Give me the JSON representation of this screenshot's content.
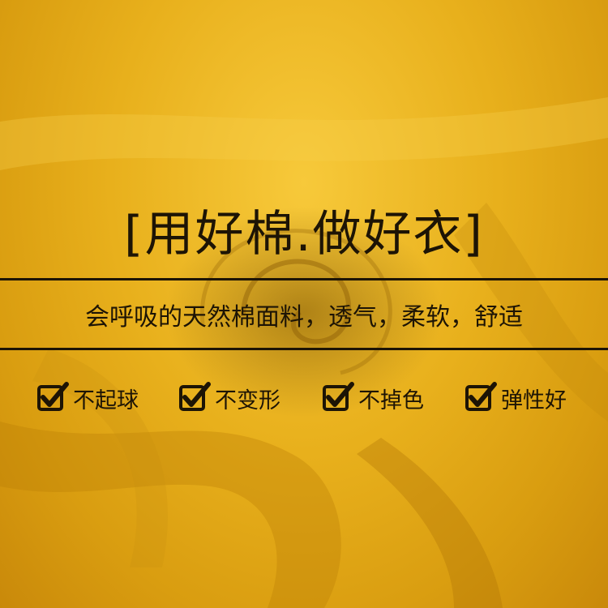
{
  "title": "[用好棉.做好衣]",
  "subtitle": "会呼吸的天然棉面料，透气，柔软，舒适",
  "features": [
    {
      "label": "不起球",
      "icon": "checkbox-icon"
    },
    {
      "label": "不变形",
      "icon": "checkbox-icon"
    },
    {
      "label": "不掉色",
      "icon": "checkbox-icon"
    },
    {
      "label": "弹性好",
      "icon": "checkbox-icon"
    }
  ],
  "colors": {
    "fabric": "#e8b01c",
    "text": "#1d1405"
  }
}
